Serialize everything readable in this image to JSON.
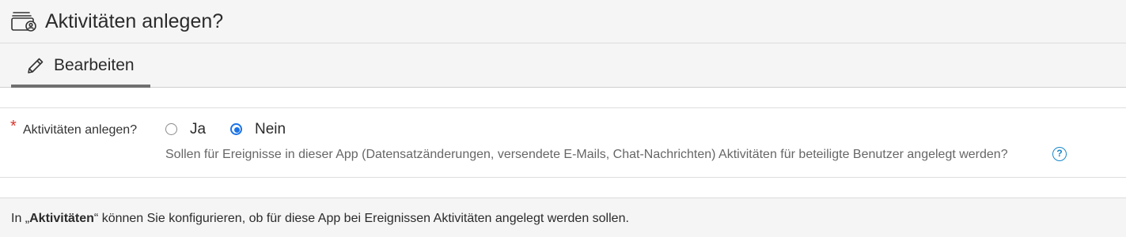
{
  "header": {
    "icon": "wallet-user-icon",
    "title": "Aktivitäten anlegen?"
  },
  "tabs": [
    {
      "label": "Bearbeiten",
      "icon": "pencil-icon",
      "active": true
    }
  ],
  "form": {
    "field_label": "Aktivitäten anlegen?",
    "required_marker": "*",
    "options": [
      {
        "label": "Ja",
        "checked": false
      },
      {
        "label": "Nein",
        "checked": true
      }
    ],
    "help_text": "Sollen für Ereignisse in dieser App (Datensatzänderungen, versendete E-Mails, Chat-Nachrichten) Aktivitäten für beteiligte Benutzer angelegt werden?",
    "help_icon": "question-circle-icon",
    "help_icon_glyph": "?"
  },
  "footer": {
    "prefix": "In „",
    "bold": "Aktivitäten",
    "suffix": "“ können Sie konfigurieren, ob für diese App bei Ereignissen Aktivitäten angelegt werden sollen."
  },
  "colors": {
    "accent": "#1a73e8",
    "required": "#d9342b",
    "help": "#1a88c9",
    "tab_underline": "#707070"
  }
}
